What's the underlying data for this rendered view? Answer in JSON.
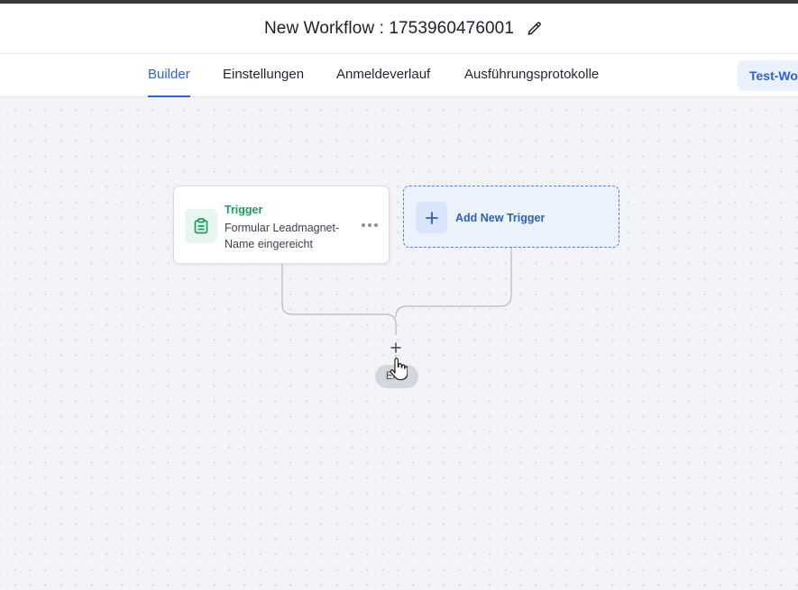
{
  "header": {
    "title": "New Workflow : 1753960476001",
    "edit_icon": "pencil-icon"
  },
  "tabs": [
    {
      "label": "Builder",
      "active": true
    },
    {
      "label": "Einstellungen",
      "active": false
    },
    {
      "label": "Anmeldeverlauf",
      "active": false
    },
    {
      "label": "Ausführungsprotokolle",
      "active": false
    }
  ],
  "test_button": {
    "label": "Test-Workflow"
  },
  "trigger": {
    "title": "Trigger",
    "description": "Formular Leadmagnet-Name eingereicht",
    "icon": "clipboard-icon",
    "menu_icon": "more-horizontal-icon"
  },
  "add_trigger": {
    "label": "Add New Trigger",
    "icon": "plus-icon"
  },
  "add_step": {
    "icon": "plus-icon"
  },
  "end_node": {
    "label": "END"
  },
  "colors": {
    "accent": "#2b63d9",
    "trigger_green": "#16a05a",
    "canvas_bg": "#f3f4f8"
  }
}
